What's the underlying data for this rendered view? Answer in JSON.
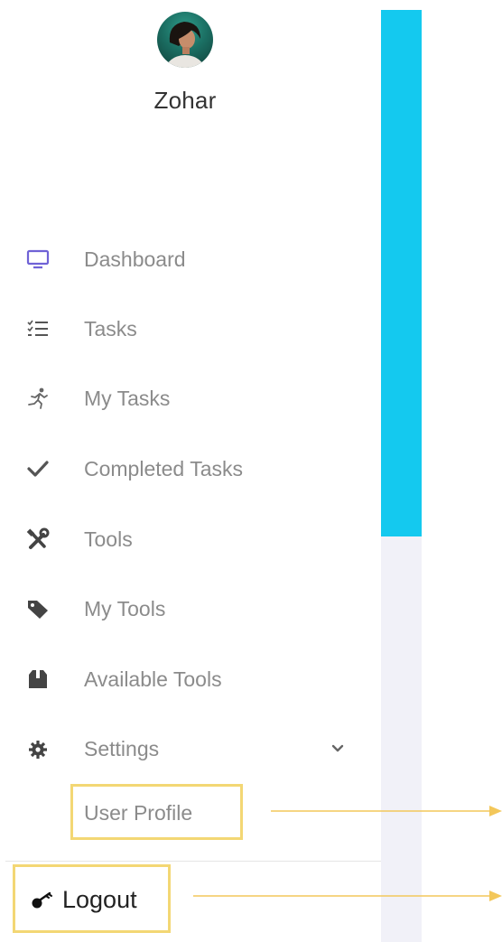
{
  "user": {
    "name": "Zohar"
  },
  "nav": [
    {
      "label": "Dashboard",
      "icon": "monitor-icon"
    },
    {
      "label": "Tasks",
      "icon": "checklist-icon"
    },
    {
      "label": "My Tasks",
      "icon": "running-icon"
    },
    {
      "label": "Completed Tasks",
      "icon": "checkmark-icon"
    },
    {
      "label": "Tools",
      "icon": "tools-icon"
    },
    {
      "label": "My Tools",
      "icon": "tag-icon"
    },
    {
      "label": "Available Tools",
      "icon": "box-icon"
    },
    {
      "label": "Settings",
      "icon": "gear-icon"
    }
  ],
  "settings_submenu": [
    {
      "label": "User Profile"
    }
  ],
  "logout": {
    "label": "Logout",
    "icon": "logout-key-icon"
  },
  "colors": {
    "accent_bar": "#14c9ef",
    "highlight_border": "#f3d774",
    "annotation_arrow": "#f3c75a",
    "dashboard_icon": "#6f62d6"
  }
}
